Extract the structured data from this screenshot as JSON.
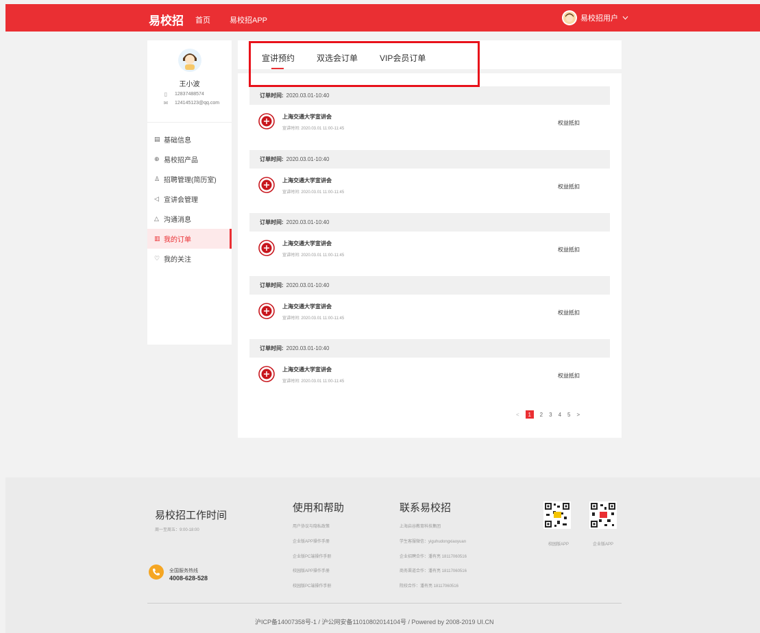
{
  "header": {
    "logo": "易校招",
    "nav": [
      "首页",
      "易校招APP"
    ],
    "user_name": "易校招用户"
  },
  "profile": {
    "name": "王小波",
    "phone": "12837488574",
    "email": "124145123@qq.com"
  },
  "menu": [
    {
      "label": "基础信息",
      "icon": "document-icon"
    },
    {
      "label": "易校招产品",
      "icon": "box-icon"
    },
    {
      "label": "招聘管理(简历室)",
      "icon": "user-icon"
    },
    {
      "label": "宣讲会管理",
      "icon": "speaker-icon"
    },
    {
      "label": "沟通消息",
      "icon": "bell-icon"
    },
    {
      "label": "我的订单",
      "icon": "order-icon",
      "active": true
    },
    {
      "label": "我的关注",
      "icon": "heart-icon"
    }
  ],
  "tabs": [
    "宣讲预约",
    "双选会订单",
    "VIP会员订单"
  ],
  "orders": [
    {
      "head_label": "订单时间:",
      "head_time": "2020.03.01-10:40",
      "title": "上海交通大学宣讲会",
      "time": "宣讲时间:  2020.03.01  11:00-11:45",
      "action": "权益抵扣"
    },
    {
      "head_label": "订单时间:",
      "head_time": "2020.03.01-10:40",
      "title": "上海交通大学宣讲会",
      "time": "宣讲时间:  2020.03.01  11:00-11:45",
      "action": "权益抵扣"
    },
    {
      "head_label": "订单时间:",
      "head_time": "2020.03.01-10:40",
      "title": "上海交通大学宣讲会",
      "time": "宣讲时间:  2020.03.01  11:00-11:45",
      "action": "权益抵扣"
    },
    {
      "head_label": "订单时间:",
      "head_time": "2020.03.01-10:40",
      "title": "上海交通大学宣讲会",
      "time": "宣讲时间:  2020.03.01  11:00-11:45",
      "action": "权益抵扣"
    },
    {
      "head_label": "订单时间:",
      "head_time": "2020.03.01-10:40",
      "title": "上海交通大学宣讲会",
      "time": "宣讲时间:  2020.03.01  11:00-11:45",
      "action": "权益抵扣"
    }
  ],
  "pagination": {
    "prev": "<",
    "pages": [
      "1",
      "2",
      "3",
      "4",
      "5"
    ],
    "current": "1",
    "next": ">"
  },
  "footer": {
    "work_title": "易校招工作时间",
    "work_hours": "周一至周五：9:00-18:00",
    "hotline_label": "全国服务热线",
    "hotline": "4008-628-528",
    "help_title": "使用和帮助",
    "help_links": [
      "用户协议与隐私政策",
      "企业版APP操作手册",
      "企业版PC端操作手册",
      "校园版APP操作手册",
      "校园版PC端操作手册"
    ],
    "contact_title": "联系易校招",
    "contact_lines": [
      "上海启谷教育科技集团",
      "学生客服微信：yiguhudongxiaoyuan",
      "企业招聘合作：潘有亮 18117060516",
      "商务渠道合作：潘有亮 18117060516",
      "院校合作：潘有亮 18117060516"
    ],
    "qr_labels": [
      "校园版APP",
      "企业版APP"
    ],
    "copyright": "沪ICP备14007358号-1 / 沪公网安备11010802014104号 / Powered by 2008-2019 UI.CN"
  },
  "colors": {
    "brand": "#ea2f33",
    "highlight": "#e8111a"
  }
}
